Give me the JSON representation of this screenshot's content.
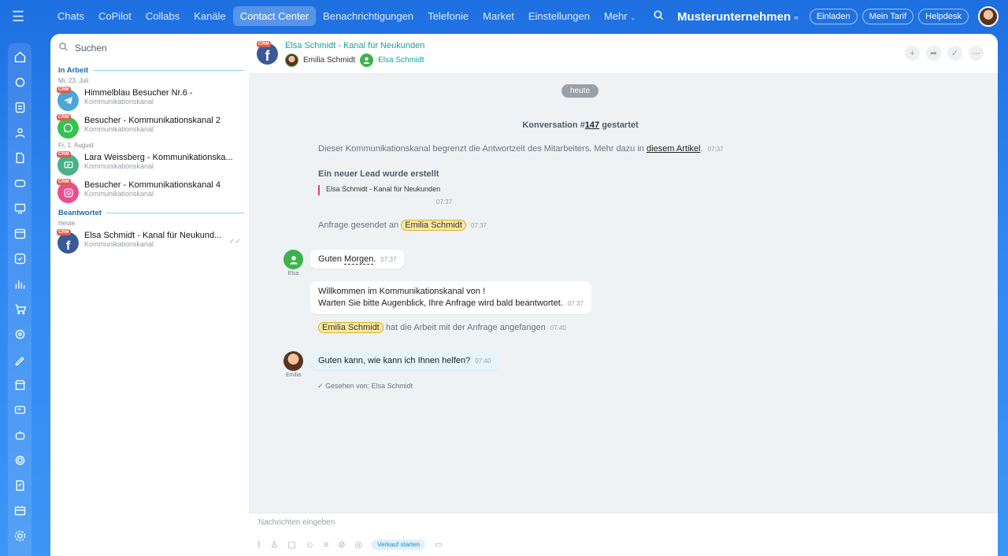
{
  "topnav": {
    "items": [
      "Chats",
      "CoPilot",
      "Collabs",
      "Kanäle",
      "Contact Center",
      "Benachrichtigungen",
      "Telefonie",
      "Market",
      "Einstellungen",
      "Mehr"
    ],
    "active_index": 4
  },
  "topright": {
    "company": "Musterunternehmen",
    "invite": "Einladen",
    "tariff": "Mein Tarif",
    "helpdesk": "Helpdesk"
  },
  "left": {
    "search_placeholder": "Suchen",
    "section_active": "In Arbeit",
    "date_1": "Mi, 23. Juli",
    "date_2": "Fr, 1. August",
    "section_answered": "Beantwortet",
    "date_3": "Heute",
    "crm_badge": "CRM",
    "conversations": [
      {
        "title": "Himmelblau Besucher Nr.6 -",
        "sub": "Kommunikationskanal",
        "channel": "telegram",
        "color": "#4aa5d8"
      },
      {
        "title": "Besucher - Kommunikationskanal 2",
        "sub": "Kommunikationskanal",
        "channel": "whatsapp",
        "color": "#35c24e"
      },
      {
        "title": "Lara Weissberg - Kommunikationska...",
        "sub": "Kommunikationskanal",
        "channel": "livechat",
        "color": "#48b08a"
      },
      {
        "title": "Besucher - Kommunikationskanal 4",
        "sub": "Kommunikationskanal",
        "channel": "instagram",
        "color": "#e94d90"
      },
      {
        "title": "Elsa Schmidt - Kanal für Neukund...",
        "sub": "Kommunikationskanal",
        "channel": "facebook",
        "color": "#3b5998"
      }
    ]
  },
  "chat": {
    "title": "Elsa Schmidt - Kanal für Neukunden",
    "member_1": "Emilia Schmidt",
    "member_2": "Elsa Schmidt",
    "day_chip": "heute",
    "conv_started_pre": "Konversation #",
    "conv_number": "147",
    "conv_started_post": " gestartet",
    "limit_text": "Dieser Kommunikationskanal begrenzt die Antwortzeit des Mitarbeiters. Mehr dazu in ",
    "limit_link": "diesem Artikel",
    "limit_time": "07:37",
    "lead_title": "Ein neuer Lead wurde erstellt",
    "lead_quote": "Elsa Schmidt - Kanal für Neukunden",
    "lead_time": "07:37",
    "request_sent": "Anfrage gesendet an",
    "request_to": "Emilia Schmidt",
    "request_time": "07:37",
    "msg1_pre": "Guten ",
    "msg1_word": "Morgen",
    "msg1_post": ".",
    "msg1_time": "07:37",
    "msg1_author": "Elsa",
    "msg2_line1": "Willkommen im Kommunikationskanal von !",
    "msg2_line2": "Warten Sie bitte Augenblick, Ihre Anfrage wird bald beantwortet.",
    "msg2_time": "07:37",
    "work_name": "Emilia Schmidt",
    "work_text": "hat die Arbeit mit der Anfrage angefangen",
    "work_time": "07:40",
    "msg3_text": "Guten kann, wie kann ich Ihnen helfen?",
    "msg3_time": "07:40",
    "msg3_author": "Emilia",
    "seen": "Gesehen von: Elsa Schmidt"
  },
  "composer": {
    "placeholder": "Nachrichten eingeben",
    "sale_button": "Verkauf starten"
  },
  "colors": {
    "brand": "#2f86f2",
    "teal": "#1a9f9b",
    "mention": "#fde9a1"
  }
}
